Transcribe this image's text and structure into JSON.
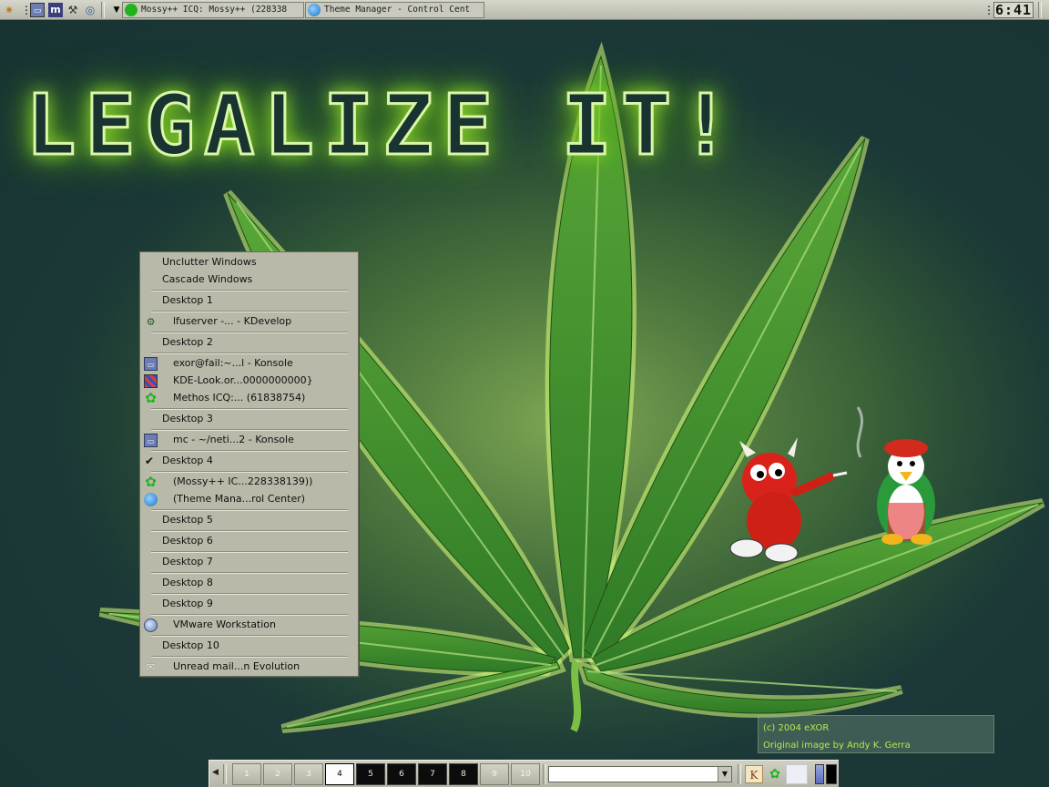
{
  "wallpaper": {
    "headline": "LEGALIZE IT!",
    "credit_line1": "(c) 2004 eXOR",
    "credit_line2": "Original image by Andy K. Gerra"
  },
  "top_panel": {
    "launcher_icons": [
      "kde-menu-icon",
      "konsole-icon",
      "mc-icon",
      "tools-icon",
      "cdrom-icon"
    ],
    "tasks": [
      {
        "label": "Mossy++ ICQ: Mossy++ (228338",
        "icon": "clover-icon"
      },
      {
        "label": "Theme Manager - Control Cent",
        "icon": "globe-icon"
      }
    ],
    "clock": "6:41"
  },
  "window_menu": {
    "unclutter": "Unclutter Windows",
    "cascade": "Cascade Windows",
    "desktops": [
      {
        "label": "Desktop 1",
        "checked": false,
        "windows": [
          {
            "label": "lfuserver -... - KDevelop",
            "icon": "kdevelop-icon"
          }
        ]
      },
      {
        "label": "Desktop 2",
        "checked": false,
        "windows": [
          {
            "label": "exor@fail:~...l - Konsole",
            "icon": "konsole-icon"
          },
          {
            "label": "KDE-Look.or...0000000000}",
            "icon": "konqueror-grid-icon"
          },
          {
            "label": "Methos ICQ:... (61838754)",
            "icon": "clover-icon"
          }
        ]
      },
      {
        "label": "Desktop 3",
        "checked": false,
        "windows": [
          {
            "label": "mc - ~/neti...2 - Konsole",
            "icon": "konsole-icon"
          }
        ]
      },
      {
        "label": "Desktop 4",
        "checked": true,
        "windows": [
          {
            "label": "(Mossy++ IC...228338139))",
            "icon": "clover-icon"
          },
          {
            "label": "(Theme Mana...rol Center)",
            "icon": "globe-icon"
          }
        ]
      },
      {
        "label": "Desktop 5",
        "checked": false,
        "windows": []
      },
      {
        "label": "Desktop 6",
        "checked": false,
        "windows": []
      },
      {
        "label": "Desktop 7",
        "checked": false,
        "windows": []
      },
      {
        "label": "Desktop 8",
        "checked": false,
        "windows": []
      },
      {
        "label": "Desktop 9",
        "checked": false,
        "windows": [
          {
            "label": "VMware Workstation",
            "icon": "vmware-icon"
          }
        ]
      },
      {
        "label": "Desktop 10",
        "checked": false,
        "windows": [
          {
            "label": "Unread mail...n Evolution",
            "icon": "mail-icon"
          }
        ]
      }
    ]
  },
  "bottom_panel": {
    "pager": [
      "1",
      "2",
      "3",
      "4",
      "5",
      "6",
      "7",
      "8",
      "9",
      "10"
    ],
    "active_desktop": "4",
    "combo_value": ""
  }
}
